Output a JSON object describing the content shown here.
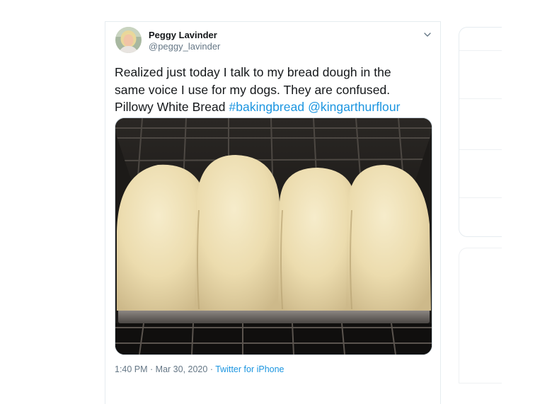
{
  "author": {
    "display_name": "Peggy Lavinder",
    "handle": "@peggy_lavinder"
  },
  "tweet": {
    "text_line1": "Realized just today I talk to my bread dough in the",
    "text_line2": "same voice I use for my dogs. They are confused.",
    "text_line3_plain": "Pillowy White Bread ",
    "hashtag": "#bakingbread",
    "mention": "@kingarthurflour"
  },
  "media": {
    "description_icon": "bread-loaves-photo"
  },
  "meta": {
    "time": "1:40 PM",
    "separator1": " · ",
    "date": "Mar 30, 2020",
    "separator2": " · ",
    "source": "Twitter for iPhone"
  },
  "colors": {
    "link": "#1b95e0",
    "secondary_text": "#657786",
    "primary_text": "#14171a",
    "border": "#e6ecf0"
  },
  "icons": {
    "caret": "chevron-down-icon"
  }
}
